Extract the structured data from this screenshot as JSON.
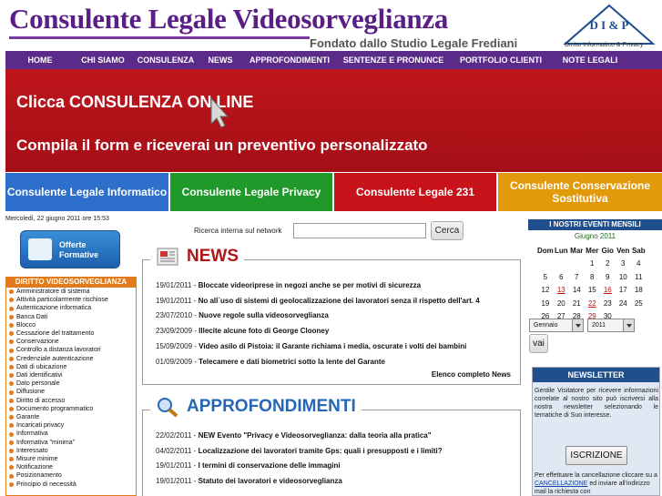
{
  "header": {
    "title": "Consulente Legale Videosorveglianza",
    "subtitle": "Fondato dallo Studio Legale Frediani",
    "logo_text": "D I & P",
    "logo_caption": "Diritto Informatico & Privacy"
  },
  "nav": [
    "HOME",
    "CHI SIAMO",
    "CONSULENZA",
    "NEWS",
    "APPROFONDIMENTI",
    "SENTENZE E PRONUNCE",
    "PORTFOLIO CLIENTI",
    "NOTE LEGALI"
  ],
  "banner": {
    "line1": "Clicca CONSULENZA ON LINE",
    "line2": "Compila il form e riceverai un preventivo personalizzato"
  },
  "boxes": [
    {
      "label": "Consulente Legale Informatico",
      "color": "#2f6fcc"
    },
    {
      "label": "Consulente Legale Privacy",
      "color": "#1f9a2a"
    },
    {
      "label": "Consulente Legale 231",
      "color": "#c8131b"
    },
    {
      "label": "Consulente Conservazione Sostitutiva",
      "color": "#e19a0c"
    }
  ],
  "date_text": "Mercoledì, 22 giugno 2011 ore 15:53",
  "offerte": {
    "label": "Offerte Formative"
  },
  "sidebar": {
    "title": "DIRITTO VIDEOSORVEGLIANZA",
    "items": [
      "Amministratore di sistema",
      "Attività particolarmente rischiose",
      "Autenticazione informatica",
      "Banca Dati",
      "Blocco",
      "Cessazione del trattamento",
      "Conservazione",
      "Controllo a distanza lavoratori",
      "Credenziale autenticazione",
      "Dati di ubicazione",
      "Dati identificativi",
      "Dato personale",
      "Diffusione",
      "Diritto di accesso",
      "Documento programmatico",
      "Garante",
      "Incaricati privacy",
      "Informativa",
      "Informativa \"minima\"",
      "Interessato",
      "Misure minime",
      "Notificazione",
      "Posizionamento",
      "Principio di necessità"
    ]
  },
  "search": {
    "label": "Ricerca interna sul network",
    "value": "",
    "button": "Cerca"
  },
  "news": {
    "title": "NEWS",
    "items": [
      {
        "date": "19/01/2011",
        "title": "Bloccate videoriprese in negozi anche se per motivi di sicurezza"
      },
      {
        "date": "19/01/2011",
        "title": "No all`uso di sistemi di geolocalizzazione dei lavoratori senza il rispetto dell'art. 4"
      },
      {
        "date": "23/07/2010",
        "title": "Nuove regole sulla videosorveglianza"
      },
      {
        "date": "23/09/2009",
        "title": "Illecite alcune foto di George Clooney"
      },
      {
        "date": "15/09/2009",
        "title": "Video asilo di Pistoia: il Garante richiama i media, oscurate i volti dei bambini"
      },
      {
        "date": "01/09/2009",
        "title": "Telecamere e dati biometrici sotto la lente del Garante"
      }
    ],
    "more": "Elenco completo News"
  },
  "approfondimenti": {
    "title": "APPROFONDIMENTI",
    "items": [
      {
        "date": "22/02/2011",
        "title": "NEW Evento \"Privacy e Videosorveglianza: dalla teoria alla pratica\""
      },
      {
        "date": "04/02/2011",
        "title": "Localizzazione dei lavoratori tramite Gps: quali i presupposti e i limiti?"
      },
      {
        "date": "19/01/2011",
        "title": "I termini di conservazione delle immagini"
      },
      {
        "date": "19/01/2011",
        "title": "Statuto dei lavoratori e videosorveglianza"
      }
    ]
  },
  "events": {
    "title": "I NOSTRI EVENTI MENSILI",
    "month_label": "Giugno 2011",
    "weekdays": [
      "Dom",
      "Lun",
      "Mar",
      "Mer",
      "Gio",
      "Ven",
      "Sab"
    ],
    "weeks": [
      [
        "",
        "",
        "",
        "1",
        "2",
        "3",
        "4"
      ],
      [
        "5",
        "6",
        "7",
        "8",
        "9",
        "10",
        "11"
      ],
      [
        "12",
        "13",
        "14",
        "15",
        "16",
        "17",
        "18"
      ],
      [
        "19",
        "20",
        "21",
        "22",
        "23",
        "24",
        "25"
      ],
      [
        "26",
        "27",
        "28",
        "29",
        "30",
        "",
        ""
      ]
    ],
    "highlighted_days": [
      "13",
      "16",
      "22",
      "29"
    ],
    "select_month": "Gennaio",
    "select_year": "2011",
    "go_button": "vai"
  },
  "newsletter": {
    "title": "NEWSLETTER",
    "text": "Gentile Visitatore per ricevere informazioni correlate al nostro sito può iscriversi alla nostra newsletter selezionando le tematiche di Suo interesse.",
    "button": "ISCRIZIONE",
    "cancel_prefix": "Per effettuare la cancellazione cliccare su a",
    "cancel_link": "CANCELLAZIONE",
    "cancel_suffix": "ed inviare all'indirizzo mail la richiesta con"
  }
}
